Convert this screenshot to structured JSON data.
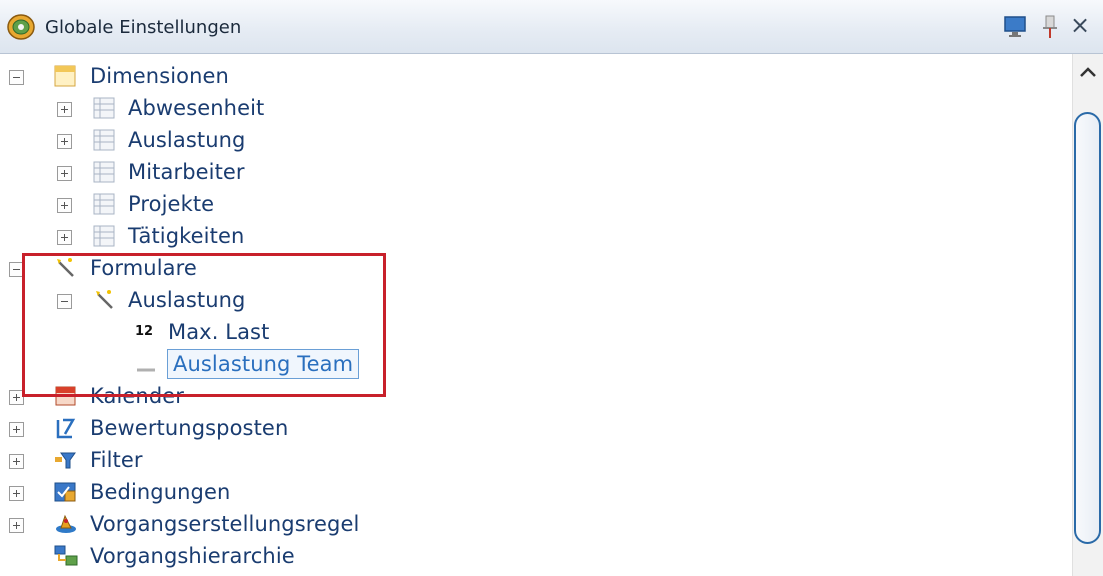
{
  "window": {
    "title": "Globale Einstellungen",
    "icons": [
      "settings-globe-icon",
      "monitor-icon",
      "pin-icon",
      "close-icon"
    ],
    "close_glyph": "×"
  },
  "tree": {
    "dimensionen": "Dimensionen",
    "abwesenheit": "Abwesenheit",
    "auslastung_dim": "Auslastung",
    "mitarbeiter": "Mitarbeiter",
    "projekte": "Projekte",
    "taetigkeiten": "Tätigkeiten",
    "formulare": "Formulare",
    "auslastung_form": "Auslastung",
    "max_last": "Max. Last",
    "max_last_badge": "12",
    "auslastung_team": "Auslastung Team",
    "kalender": "Kalender",
    "bewertungsposten": "Bewertungsposten",
    "filter": "Filter",
    "bedingungen": "Bedingungen",
    "vorgangserstellungsregel": "Vorgangserstellungsregel",
    "vorgangshierarchie": "Vorgangshierarchie"
  },
  "colors": {
    "label": "#1a3c70",
    "selection_border": "#6a9fd6",
    "highlight_box": "#c8202a",
    "scroll_thumb_border": "#2a6aa8"
  }
}
